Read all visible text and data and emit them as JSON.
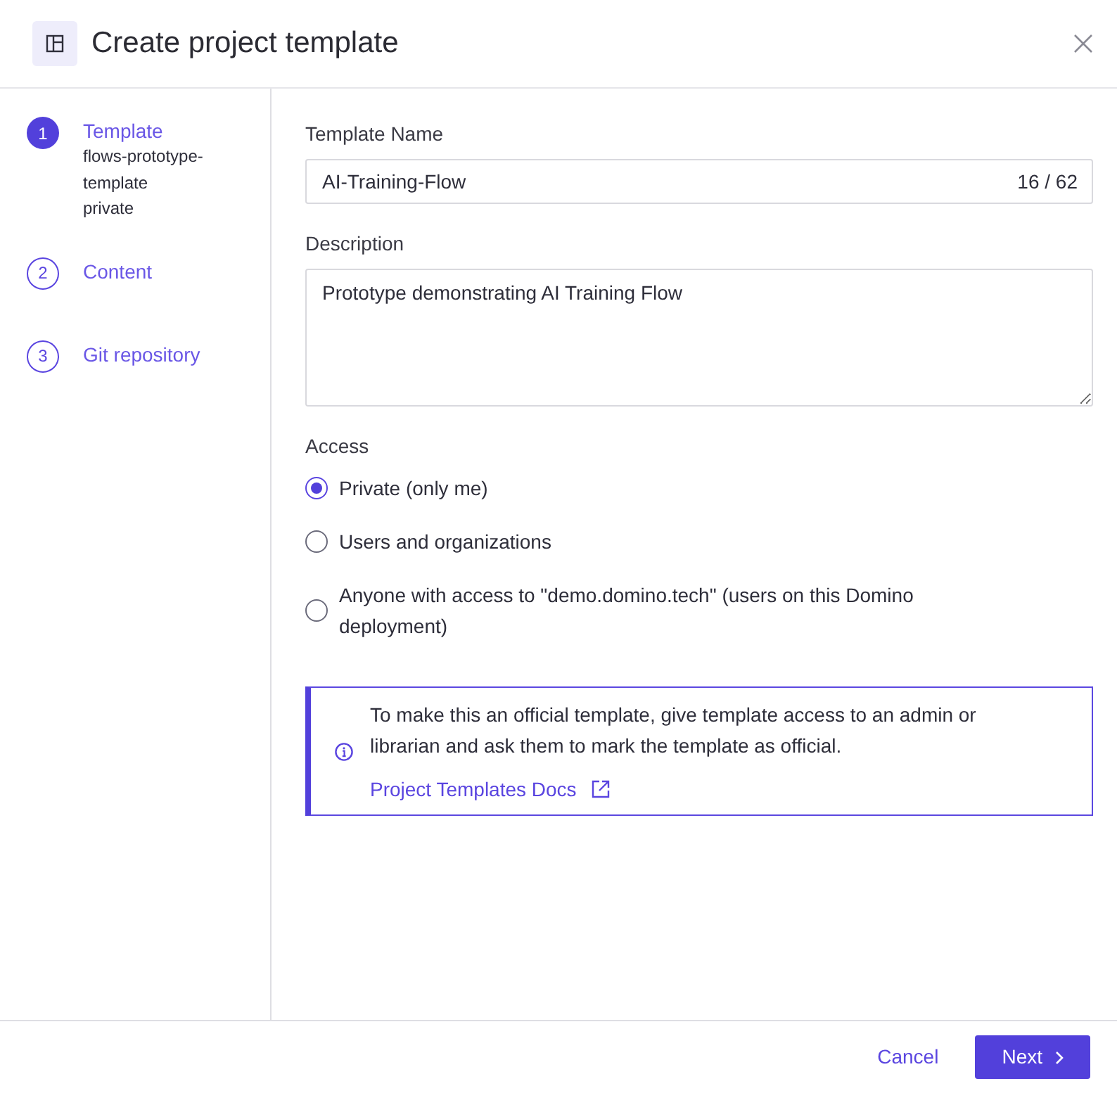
{
  "dialog": {
    "title": "Create project template"
  },
  "steps": [
    {
      "number": "1",
      "label": "Template",
      "selected": true,
      "details": [
        "flows-prototype-template",
        "private"
      ]
    },
    {
      "number": "2",
      "label": "Content",
      "selected": false
    },
    {
      "number": "3",
      "label": "Git repository",
      "selected": false
    }
  ],
  "form": {
    "name_field": {
      "label": "Template Name",
      "value": "AI-Training-Flow",
      "counter": "16 / 62"
    },
    "description_field": {
      "label": "Description",
      "value": "Prototype demonstrating AI Training Flow"
    },
    "access": {
      "label": "Access",
      "options": [
        {
          "label": "Private (only me)",
          "selected": true
        },
        {
          "label": "Users and organizations",
          "selected": false
        },
        {
          "label": "Anyone with access to \"demo.domino.tech\" (users on this Domino deployment)",
          "selected": false
        }
      ]
    }
  },
  "info_note": {
    "text": "To make this an official template, give template access to an admin or librarian and ask them to mark the template as official.",
    "link": "Project Templates Docs"
  },
  "footer": {
    "buttons": [
      {
        "label": "Cancel",
        "kind": "link"
      },
      {
        "label": "Next",
        "kind": "primary"
      }
    ]
  }
}
